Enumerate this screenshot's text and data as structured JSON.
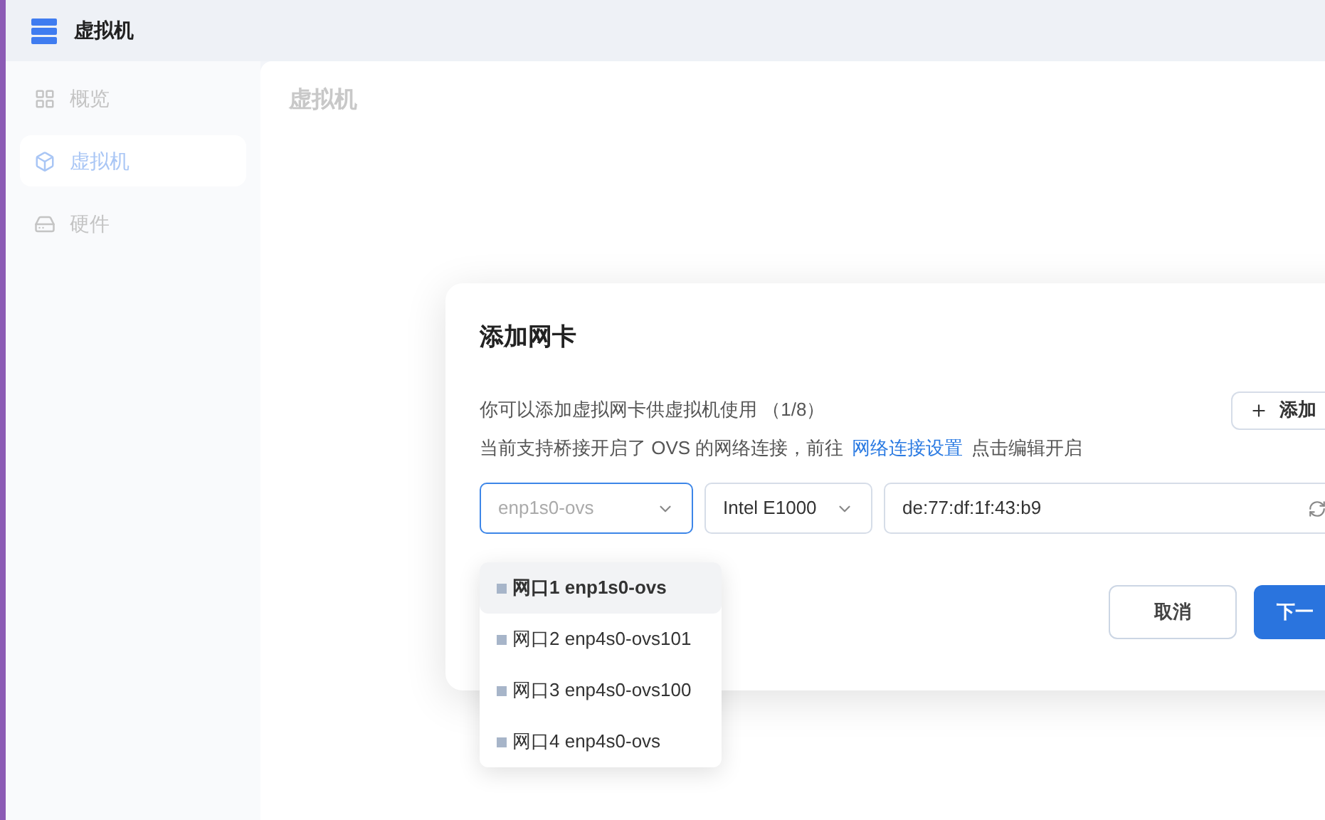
{
  "app": {
    "title": "虚拟机"
  },
  "sidebar": {
    "items": [
      {
        "label": "概览",
        "kind": "grid",
        "selected": false
      },
      {
        "label": "虚拟机",
        "kind": "cube",
        "selected": true
      },
      {
        "label": "硬件",
        "kind": "drive",
        "selected": false
      }
    ]
  },
  "main": {
    "title": "虚拟机"
  },
  "dialog": {
    "title": "添加网卡",
    "description": "你可以添加虚拟网卡供虚拟机使用 （1/8）",
    "add_button": "添加",
    "note_before": "当前支持桥接开启了 OVS 的网络连接，前往",
    "note_link": "网络连接设置",
    "note_after": "点击编辑开启",
    "interface_select": {
      "placeholder": "enp1s0-ovs",
      "expanded": true
    },
    "model_select": {
      "value": "Intel E1000"
    },
    "mac_field": {
      "value": "de:77:df:1f:43:b9"
    },
    "options": [
      {
        "label": "网口1 enp1s0-ovs",
        "selected": true
      },
      {
        "label": "网口2 enp4s0-ovs101",
        "selected": false
      },
      {
        "label": "网口3 enp4s0-ovs100",
        "selected": false
      },
      {
        "label": "网口4 enp4s0-ovs",
        "selected": false
      }
    ],
    "buttons": [
      "取消",
      "下一"
    ]
  }
}
